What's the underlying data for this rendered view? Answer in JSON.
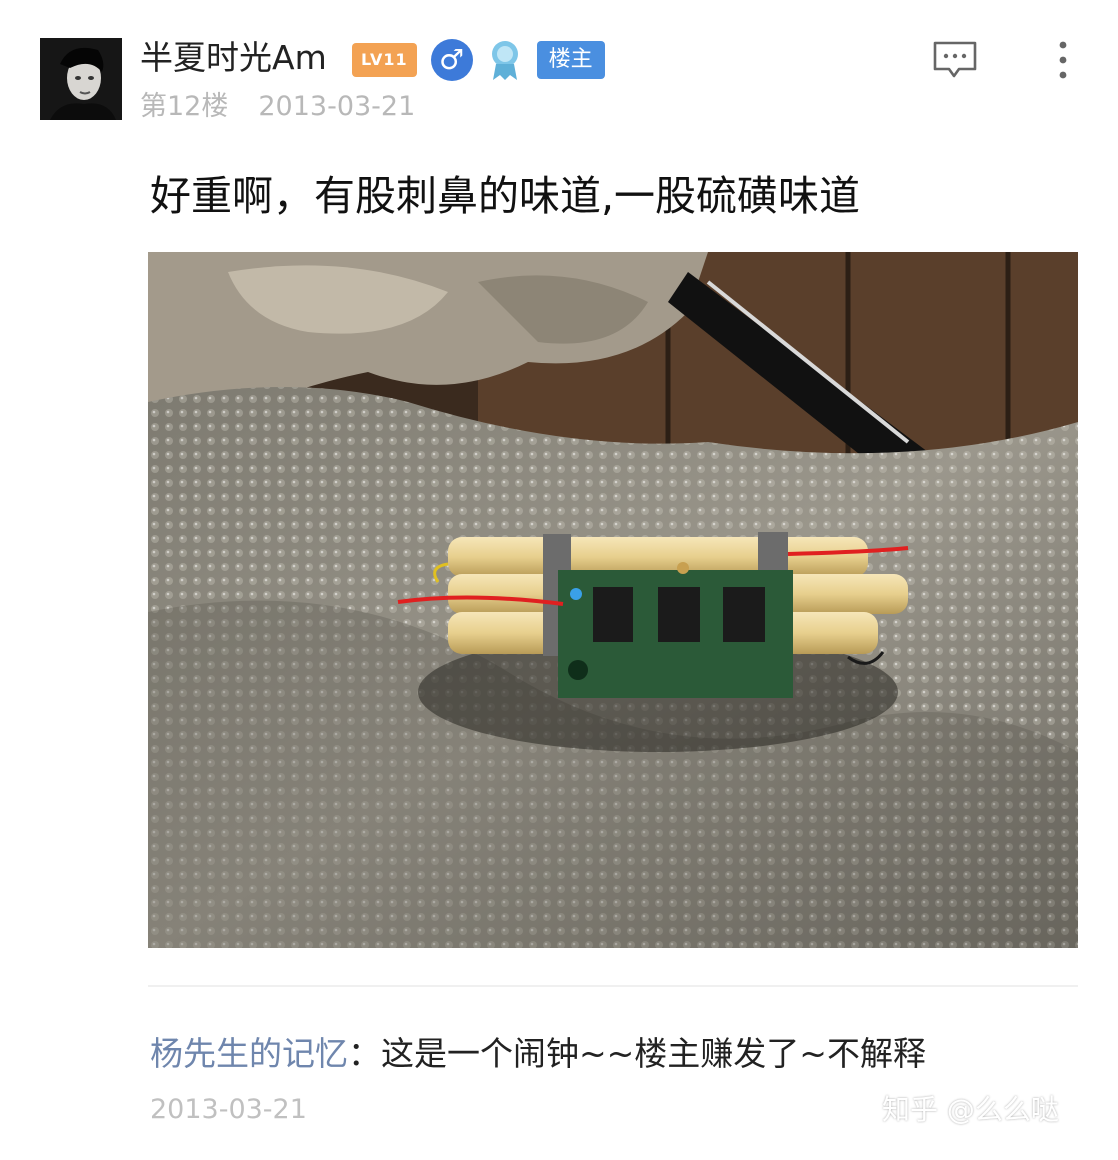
{
  "post": {
    "username": "半夏时光Am",
    "level_badge": "LV11",
    "gender_icon": "♂",
    "role_badge": "楼主",
    "floor": "第12楼",
    "date": "2013-03-21",
    "text": "好重啊，有股刺鼻的味道,一股硫磺味道",
    "icons": [
      "avatar",
      "male-icon",
      "medal-icon",
      "comment-icon",
      "more-icon"
    ]
  },
  "reply": {
    "author": "杨先生的记忆",
    "separator": "：",
    "content": "这是一个闹钟~~楼主赚发了~不解释",
    "date": "2013-03-21"
  },
  "watermark": "知乎 @么么哒",
  "colors": {
    "level_badge": "#f3a253",
    "gender": "#3d7ad9",
    "role_badge": "#4a8fe0",
    "reply_author": "#6f86ad",
    "meta_text": "#b8b8b8"
  }
}
